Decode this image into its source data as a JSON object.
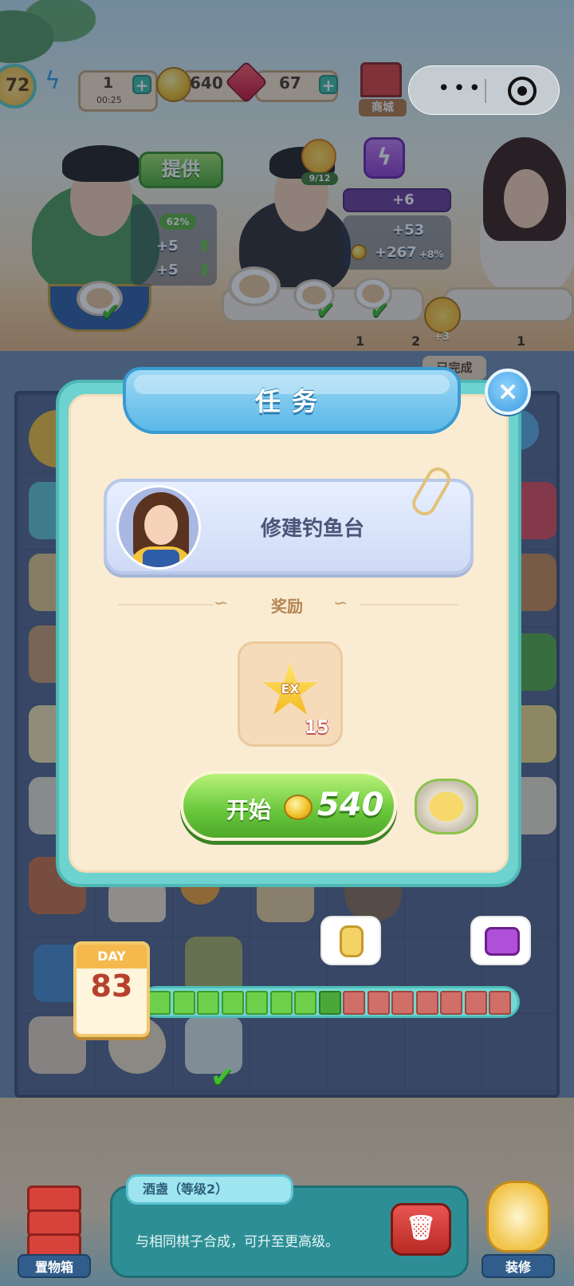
{
  "hud": {
    "level": "72",
    "energy_count": "1",
    "energy_timer": "00:25",
    "coins": "640",
    "gems": "67",
    "shop_label": "商城",
    "plus_symbol": "+"
  },
  "customers": {
    "offer_label": "提供",
    "left_stats": {
      "percent": "62%",
      "stat_a": "+5",
      "stat_b": "+5"
    },
    "middle_progress": "9/12",
    "hammer_bonus": "+6",
    "cup_bonus": "+53",
    "coin_bonus": "+267",
    "coin_bonus_pct": "+8%",
    "ticket_count_1": "1",
    "ticket_count_2": "2",
    "ticket_count_3": "1",
    "sun_plus": "+3",
    "completed_tag": "已完成"
  },
  "dialog": {
    "title": "任务",
    "close_symbol": "×",
    "task_name": "修建钓鱼台",
    "reward_label": "奖励",
    "reward_icon_text": "EX",
    "reward_count": "15",
    "start_label": "开始",
    "start_price": "540"
  },
  "day_bar": {
    "day_label": "DAY",
    "day_number": "83",
    "segments_done": 7,
    "segments_today": 1,
    "segments_todo": 7
  },
  "bottom": {
    "storage_label": "置物箱",
    "item_name": "酒盏（等级2）",
    "item_desc": "与相同棋子合成，可升至更高级。",
    "decor_label": "装修"
  },
  "icons": {
    "bolt": "lightning-icon",
    "coin": "coin-icon",
    "gem": "gem-icon",
    "shop": "shop-icon",
    "close": "close-icon",
    "trash": "trash-icon"
  },
  "colors": {
    "dialog_frame": "#6ed3cf",
    "title_ribbon": "#5ab8e8",
    "start_button": "#67c63a",
    "segment_done": "#6ed04a",
    "segment_todo": "#cf6f68"
  }
}
